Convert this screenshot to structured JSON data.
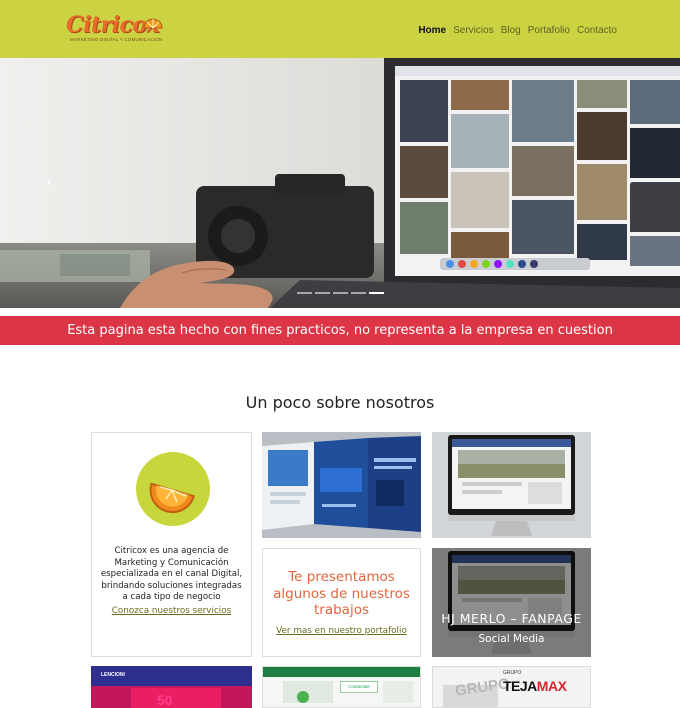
{
  "brand": {
    "name": "Citricox",
    "tagline": "MARKETING DIGITAL Y COMUNICACIÓN"
  },
  "nav": {
    "items": [
      {
        "label": "Home",
        "active": true
      },
      {
        "label": "Servicios",
        "active": false
      },
      {
        "label": "Blog",
        "active": false
      },
      {
        "label": "Portafolio",
        "active": false
      },
      {
        "label": "Contacto",
        "active": false
      }
    ]
  },
  "carousel": {
    "prev_icon": "chevron-left-icon",
    "next_icon": "chevron-right-icon",
    "slide_count": 5,
    "active_slide": 5
  },
  "notice": {
    "text": "Esta pagina esta hecho con fines practicos, no representa a la empresa en cuestion"
  },
  "about": {
    "title": "Un poco sobre nosotros",
    "description": "Citricox es una agencia de Marketing y Comunicación especializada en el canal Digital, brindando soluciones integradas a cada tipo de negocio",
    "link": "Conozca nuestros servicios"
  },
  "portfolio": {
    "intro": "Te presentamos algunos de nuestros trabajos",
    "link": "Ver mas en nuestro portafolio",
    "featured_title": "HJ MERLO – FANPAGE",
    "featured_subtitle": "Social Media",
    "thumb_texts": {
      "lencioni": "LENCIONI",
      "fifty": "50",
      "contactate": "Contactate",
      "grupo": "GRUPO",
      "teja": "TEJA",
      "max": "MAX"
    }
  },
  "colors": {
    "navbar": "#ccd343",
    "banner": "#dc3545",
    "accent": "#e0663e",
    "link": "#6b6b1e"
  }
}
